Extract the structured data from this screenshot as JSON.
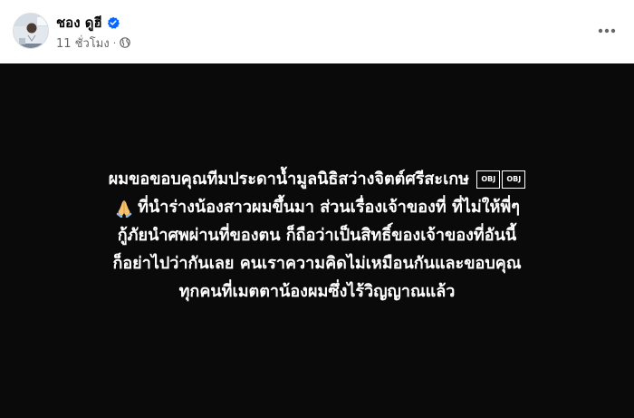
{
  "post": {
    "author": "ชอง ดูฮี",
    "timestamp": "11 ชั่วโมง",
    "separator": "·",
    "audience_icon": "globe-icon",
    "verified_icon": "verified-badge-icon",
    "more_icon": "more-options-icon",
    "accent_color": "#0866ff",
    "canvas_background": "#0a0a0a",
    "text_lines": [
      "ผมขอขอบคุณทีมประดาน้ำมูลนิธิสว่างจิตต์ศรีสะเกษ",
      "ที่นำร่างน้องสาวผมขึ้นมา ส่วนเรื่องเจ้าของที่ ที่ไม่ให้พี่ๆ",
      "กู้ภัยนำศพผ่านที่ของตน ก็ถือว่าเป็นสิทธิ์ของเจ้าของที่อันนี้",
      "ก็อย่าไปว่ากันเลย คนเราความคิดไม่เหมือนกันและขอบคุณ",
      "ทุกคนที่เมตตาน้องผมซึ่งไร้วิญญาณแล้ว"
    ],
    "obj_glyph_label": "OBJ",
    "emoji_icon": "folded-hands-icon"
  }
}
